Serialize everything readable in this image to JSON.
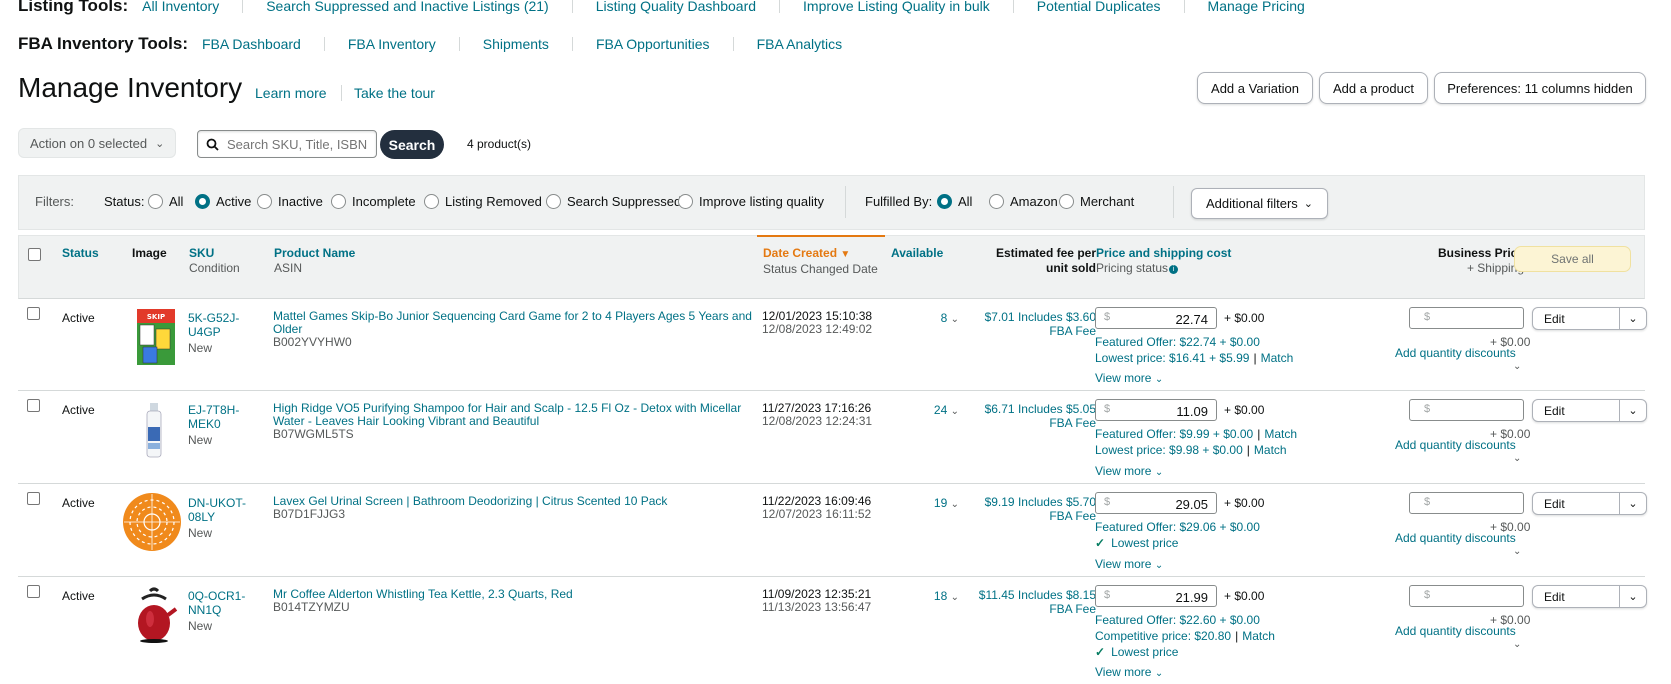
{
  "listing_tools": {
    "label": "Listing Tools:",
    "links": [
      "All Inventory",
      "Search Suppressed and Inactive Listings (21)",
      "Listing Quality Dashboard",
      "Improve Listing Quality in bulk",
      "Potential Duplicates",
      "Manage Pricing"
    ]
  },
  "fba_tools": {
    "label": "FBA Inventory Tools:",
    "links": [
      "FBA Dashboard",
      "FBA Inventory",
      "Shipments",
      "FBA Opportunities",
      "FBA Analytics"
    ]
  },
  "header": {
    "title": "Manage Inventory",
    "learn_more": "Learn more",
    "take_tour": "Take the tour",
    "add_variation": "Add a Variation",
    "add_product": "Add a product",
    "preferences": "Preferences: 11 columns hidden"
  },
  "search": {
    "action": "Action on 0 selected",
    "placeholder": "Search SKU, Title, ISBN,",
    "button": "Search",
    "count": "4 product(s)"
  },
  "filters": {
    "label": "Filters:",
    "status_label": "Status:",
    "status_options": [
      "All",
      "Active",
      "Inactive",
      "Incomplete",
      "Listing Removed",
      "Search Suppressed",
      "Improve listing quality"
    ],
    "status_selected": "Active",
    "fulfilled_label": "Fulfilled By:",
    "fulfilled_options": [
      "All",
      "Amazon",
      "Merchant"
    ],
    "fulfilled_selected": "All",
    "additional": "Additional filters"
  },
  "columns": {
    "status": "Status",
    "image": "Image",
    "sku": "SKU",
    "condition": "Condition",
    "product_name": "Product Name",
    "asin": "ASIN",
    "date_created": "Date Created",
    "status_changed": "Status Changed Date",
    "available": "Available",
    "fee_1": "Estimated fee per",
    "fee_2": "unit sold",
    "price": "Price and shipping cost",
    "pricing_status": "Pricing status",
    "business_price": "Business Price",
    "shipping": "+ Shipping",
    "save_all": "Save all"
  },
  "rows": [
    {
      "status": "Active",
      "sku": "5K-G52J-U4GP",
      "condition": "New",
      "name": "Mattel Games Skip-Bo Junior Sequencing Card Game for 2 to 4 Players Ages 5 Years and Older",
      "asin": "B002YVYHW0",
      "created": "12/01/2023 15:10:38",
      "changed": "12/08/2023 12:49:02",
      "available": "8",
      "fee": "$7.01 Includes $3.60 FBA Fee",
      "price": "22.74",
      "ship": "+ $0.00",
      "line1": "Featured Offer: $22.74 + $0.00",
      "line2": "Lowest price: $16.41 + $5.99",
      "line2_match": "Match",
      "line3": "",
      "view_more": "View more",
      "biz_ship": "+ $0.00",
      "qd": "Add quantity discounts",
      "edit": "Edit"
    },
    {
      "status": "Active",
      "sku": "EJ-7T8H-MEK0",
      "condition": "New",
      "name": "High Ridge VO5 Purifying Shampoo for Hair and Scalp - 12.5 Fl Oz - Detox with Micellar Water - Leaves Hair Looking Vibrant and Beautiful",
      "asin": "B07WGML5TS",
      "created": "11/27/2023 17:16:26",
      "changed": "12/08/2023 12:24:31",
      "available": "24",
      "fee": "$6.71 Includes $5.05 FBA Fee",
      "price": "11.09",
      "ship": "+ $0.00",
      "line1": "Featured Offer: $9.99 + $0.00",
      "line1_match": "Match",
      "line2": "Lowest price: $9.98 + $0.00",
      "line2_match": "Match",
      "line3": "",
      "view_more": "View more",
      "biz_ship": "+ $0.00",
      "qd": "Add quantity discounts",
      "edit": "Edit"
    },
    {
      "status": "Active",
      "sku": "DN-UKOT-08LY",
      "condition": "New",
      "name": "Lavex Gel Urinal Screen | Bathroom Deodorizing | Citrus Scented 10 Pack",
      "asin": "B07D1FJJG3",
      "created": "11/22/2023 16:09:46",
      "changed": "12/07/2023 16:11:52",
      "available": "19",
      "fee": "$9.19 Includes $5.70 FBA Fee",
      "price": "29.05",
      "ship": "+ $0.00",
      "line1": "Featured Offer: $29.06 + $0.00",
      "line2": "Lowest price",
      "line3": "",
      "view_more": "View more",
      "biz_ship": "+ $0.00",
      "qd": "Add quantity discounts",
      "edit": "Edit"
    },
    {
      "status": "Active",
      "sku": "0Q-OCR1-NN1Q",
      "condition": "New",
      "name": "Mr Coffee Alderton Whistling Tea Kettle, 2.3 Quarts, Red",
      "asin": "B014TZYMZU",
      "created": "11/09/2023 12:35:21",
      "changed": "11/13/2023 13:56:47",
      "available": "18",
      "fee": "$11.45 Includes $8.15 FBA Fee",
      "price": "21.99",
      "ship": "+ $0.00",
      "line1": "Featured Offer: $22.60 + $0.00",
      "line2": "Competitive price: $20.80",
      "line2_match": "Match",
      "line3": "Lowest price",
      "view_more": "View more",
      "biz_ship": "+ $0.00",
      "qd": "Add quantity discounts",
      "edit": "Edit"
    }
  ],
  "colors": {
    "link": "#007185",
    "accent_orange": "#e47911",
    "dark_button": "#232f3e",
    "success": "#067d62"
  }
}
